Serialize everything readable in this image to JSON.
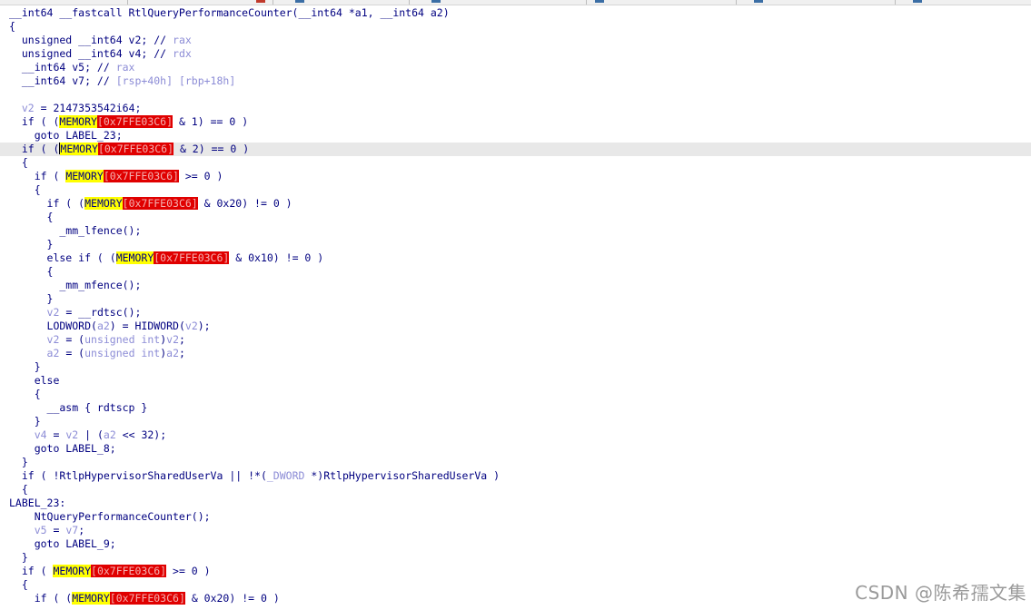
{
  "window": {
    "tabs_hint": [
      "",
      "",
      "",
      "",
      "",
      "",
      "",
      "",
      ""
    ]
  },
  "code": {
    "lines": [
      [
        {
          "t": "__int64 __fastcall RtlQueryPerformanceCounter(__int64 *a1, __int64 a2)",
          "k": "plain"
        }
      ],
      [
        {
          "t": "{",
          "k": "plain"
        }
      ],
      [
        {
          "t": "  unsigned __int64 v2; // ",
          "k": "plain"
        },
        {
          "t": "rax",
          "k": "comment"
        }
      ],
      [
        {
          "t": "  unsigned __int64 v4; // ",
          "k": "plain"
        },
        {
          "t": "rdx",
          "k": "comment"
        }
      ],
      [
        {
          "t": "  __int64 v5; // ",
          "k": "plain"
        },
        {
          "t": "rax",
          "k": "comment"
        }
      ],
      [
        {
          "t": "  __int64 v7; // ",
          "k": "plain"
        },
        {
          "t": "[rsp+40h] [rbp+18h]",
          "k": "comment"
        }
      ],
      [
        {
          "t": "",
          "k": "plain"
        }
      ],
      [
        {
          "t": "  ",
          "k": "plain"
        },
        {
          "t": "v2",
          "k": "var"
        },
        {
          "t": " = 2147353542i64;",
          "k": "plain"
        }
      ],
      [
        {
          "t": "  if ( (",
          "k": "plain"
        },
        {
          "t": "MEMORY",
          "k": "macro"
        },
        {
          "t": "[0x7FFE03C6]",
          "k": "addr"
        },
        {
          "t": " & 1) == 0 )",
          "k": "plain"
        }
      ],
      [
        {
          "t": "    goto LABEL_23;",
          "k": "plain"
        }
      ],
      [
        {
          "t": "  if ( (",
          "k": "plain"
        },
        {
          "t": "|",
          "k": "caret"
        },
        {
          "t": "MEMORY",
          "k": "macro"
        },
        {
          "t": "[0x7FFE03C6]",
          "k": "addr"
        },
        {
          "t": " & 2) == 0 )",
          "k": "plain"
        }
      ],
      [
        {
          "t": "  {",
          "k": "plain"
        }
      ],
      [
        {
          "t": "    if ( ",
          "k": "plain"
        },
        {
          "t": "MEMORY",
          "k": "macro"
        },
        {
          "t": "[0x7FFE03C6]",
          "k": "addr"
        },
        {
          "t": " >= 0 )",
          "k": "plain"
        }
      ],
      [
        {
          "t": "    {",
          "k": "plain"
        }
      ],
      [
        {
          "t": "      if ( (",
          "k": "plain"
        },
        {
          "t": "MEMORY",
          "k": "macro"
        },
        {
          "t": "[0x7FFE03C6]",
          "k": "addr"
        },
        {
          "t": " & 0x20) != 0 )",
          "k": "plain"
        }
      ],
      [
        {
          "t": "      {",
          "k": "plain"
        }
      ],
      [
        {
          "t": "        _mm_lfence();",
          "k": "plain"
        }
      ],
      [
        {
          "t": "      }",
          "k": "plain"
        }
      ],
      [
        {
          "t": "      else if ( (",
          "k": "plain"
        },
        {
          "t": "MEMORY",
          "k": "macro"
        },
        {
          "t": "[0x7FFE03C6]",
          "k": "addr"
        },
        {
          "t": " & 0x10) != 0 )",
          "k": "plain"
        }
      ],
      [
        {
          "t": "      {",
          "k": "plain"
        }
      ],
      [
        {
          "t": "        _mm_mfence();",
          "k": "plain"
        }
      ],
      [
        {
          "t": "      }",
          "k": "plain"
        }
      ],
      [
        {
          "t": "      ",
          "k": "plain"
        },
        {
          "t": "v2",
          "k": "var"
        },
        {
          "t": " = __rdtsc();",
          "k": "plain"
        }
      ],
      [
        {
          "t": "      LODWORD(",
          "k": "plain"
        },
        {
          "t": "a2",
          "k": "var"
        },
        {
          "t": ") = HIDWORD(",
          "k": "plain"
        },
        {
          "t": "v2",
          "k": "var"
        },
        {
          "t": ");",
          "k": "plain"
        }
      ],
      [
        {
          "t": "      ",
          "k": "plain"
        },
        {
          "t": "v2",
          "k": "var"
        },
        {
          "t": " = (",
          "k": "plain"
        },
        {
          "t": "unsigned int",
          "k": "var"
        },
        {
          "t": ")",
          "k": "plain"
        },
        {
          "t": "v2",
          "k": "var"
        },
        {
          "t": ";",
          "k": "plain"
        }
      ],
      [
        {
          "t": "      ",
          "k": "plain"
        },
        {
          "t": "a2",
          "k": "var"
        },
        {
          "t": " = (",
          "k": "plain"
        },
        {
          "t": "unsigned int",
          "k": "var"
        },
        {
          "t": ")",
          "k": "plain"
        },
        {
          "t": "a2",
          "k": "var"
        },
        {
          "t": ";",
          "k": "plain"
        }
      ],
      [
        {
          "t": "    }",
          "k": "plain"
        }
      ],
      [
        {
          "t": "    else",
          "k": "plain"
        }
      ],
      [
        {
          "t": "    {",
          "k": "plain"
        }
      ],
      [
        {
          "t": "      __asm { rdtscp }",
          "k": "plain"
        }
      ],
      [
        {
          "t": "    }",
          "k": "plain"
        }
      ],
      [
        {
          "t": "    ",
          "k": "plain"
        },
        {
          "t": "v4",
          "k": "var"
        },
        {
          "t": " = ",
          "k": "plain"
        },
        {
          "t": "v2",
          "k": "var"
        },
        {
          "t": " | (",
          "k": "plain"
        },
        {
          "t": "a2",
          "k": "var"
        },
        {
          "t": " << 32);",
          "k": "plain"
        }
      ],
      [
        {
          "t": "    goto LABEL_8;",
          "k": "plain"
        }
      ],
      [
        {
          "t": "  }",
          "k": "plain"
        }
      ],
      [
        {
          "t": "  if ( !RtlpHypervisorSharedUserVa || !*(",
          "k": "plain"
        },
        {
          "t": "_DWORD",
          "k": "var"
        },
        {
          "t": " *)RtlpHypervisorSharedUserVa )",
          "k": "plain"
        }
      ],
      [
        {
          "t": "  {",
          "k": "plain"
        }
      ],
      [
        {
          "t": "LABEL_23:",
          "k": "label"
        }
      ],
      [
        {
          "t": "    NtQueryPerformanceCounter();",
          "k": "plain"
        }
      ],
      [
        {
          "t": "    ",
          "k": "plain"
        },
        {
          "t": "v5",
          "k": "var"
        },
        {
          "t": " = ",
          "k": "plain"
        },
        {
          "t": "v7",
          "k": "var"
        },
        {
          "t": ";",
          "k": "plain"
        }
      ],
      [
        {
          "t": "    goto LABEL_9;",
          "k": "plain"
        }
      ],
      [
        {
          "t": "  }",
          "k": "plain"
        }
      ],
      [
        {
          "t": "  if ( ",
          "k": "plain"
        },
        {
          "t": "MEMORY",
          "k": "macro"
        },
        {
          "t": "[0x7FFE03C6]",
          "k": "addr"
        },
        {
          "t": " >= 0 )",
          "k": "plain"
        }
      ],
      [
        {
          "t": "  {",
          "k": "plain"
        }
      ],
      [
        {
          "t": "    if ( (",
          "k": "plain"
        },
        {
          "t": "MEMORY",
          "k": "macro"
        },
        {
          "t": "[0x7FFE03C6]",
          "k": "addr"
        },
        {
          "t": " & 0x20) != 0 )",
          "k": "plain"
        }
      ]
    ],
    "highlighted_line_index": 10
  },
  "watermark": {
    "text": "CSDN @陈希孺文集"
  }
}
